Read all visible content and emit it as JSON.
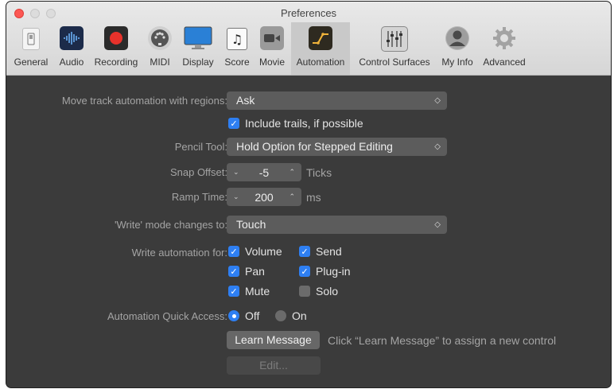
{
  "window": {
    "title": "Preferences"
  },
  "toolbar": {
    "items": [
      {
        "label": "General",
        "icon": "switch-icon"
      },
      {
        "label": "Audio",
        "icon": "waveform-icon"
      },
      {
        "label": "Recording",
        "icon": "record-icon"
      },
      {
        "label": "MIDI",
        "icon": "midi-connector-icon"
      },
      {
        "label": "Display",
        "icon": "monitor-icon"
      },
      {
        "label": "Score",
        "icon": "music-note-icon"
      },
      {
        "label": "Movie",
        "icon": "video-camera-icon"
      },
      {
        "label": "Automation",
        "icon": "automation-curve-icon",
        "active": true
      },
      {
        "label": "Control Surfaces",
        "icon": "faders-icon"
      },
      {
        "label": "My Info",
        "icon": "person-icon"
      },
      {
        "label": "Advanced",
        "icon": "gear-icon"
      }
    ]
  },
  "settings": {
    "move_track_automation": {
      "label": "Move track automation with regions:",
      "value": "Ask"
    },
    "include_trails": {
      "label": "Include trails, if possible",
      "checked": true
    },
    "pencil_tool": {
      "label": "Pencil Tool:",
      "value": "Hold Option for Stepped Editing"
    },
    "snap_offset": {
      "label": "Snap Offset:",
      "value": "-5",
      "unit": "Ticks"
    },
    "ramp_time": {
      "label": "Ramp Time:",
      "value": "200",
      "unit": "ms"
    },
    "write_mode": {
      "label": "'Write' mode changes to:",
      "value": "Touch"
    },
    "write_automation_for": {
      "label": "Write automation for:",
      "volume": {
        "label": "Volume",
        "checked": true
      },
      "send": {
        "label": "Send",
        "checked": true
      },
      "pan": {
        "label": "Pan",
        "checked": true
      },
      "plugin": {
        "label": "Plug-in",
        "checked": true
      },
      "mute": {
        "label": "Mute",
        "checked": true
      },
      "solo": {
        "label": "Solo",
        "checked": false
      }
    },
    "quick_access": {
      "label": "Automation Quick Access:",
      "off": {
        "label": "Off",
        "selected": true
      },
      "on": {
        "label": "On",
        "selected": false
      }
    },
    "learn_message": {
      "button": "Learn Message",
      "hint": "Click “Learn Message” to assign a new control"
    },
    "edit_button": "Edit..."
  },
  "colors": {
    "accent": "#2e7ff2",
    "record": "#e8322b",
    "close": "#fc5753"
  }
}
